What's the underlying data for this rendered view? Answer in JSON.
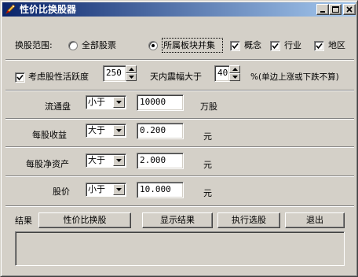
{
  "window": {
    "title": "性价比换股器",
    "icon": "pencil-icon",
    "controls": [
      "minimize-icon",
      "maximize-icon",
      "close-icon"
    ]
  },
  "range": {
    "label": "换股范围:",
    "option_all": "全部股票",
    "option_sector": "所属板块并集",
    "selected": "所属板块并集",
    "concept_label": "概念",
    "concept_checked": true,
    "industry_label": "行业",
    "industry_checked": true,
    "region_label": "地区",
    "region_checked": true
  },
  "activity": {
    "checkbox_label": "考虑股性活跃度",
    "checked": true,
    "days_value": "250",
    "text_mid": "天内震幅大于",
    "amplitude_value": "40",
    "text_suffix": "%(单边上涨或下跌不算)"
  },
  "conditions": [
    {
      "label": "流通盘",
      "operator": "小于",
      "value": "10000",
      "unit": "万股"
    },
    {
      "label": "每股收益",
      "operator": "大于",
      "value": "0.200",
      "unit": "元"
    },
    {
      "label": "每股净资产",
      "operator": "大于",
      "value": "2.000",
      "unit": "元"
    },
    {
      "label": "股价",
      "operator": "小于",
      "value": "10.000",
      "unit": "元"
    }
  ],
  "footer": {
    "result_label": "结果",
    "btn_swap": "性价比换股",
    "btn_show": "显示结果",
    "btn_run": "执行选股",
    "btn_exit": "退出",
    "result_text": ""
  }
}
